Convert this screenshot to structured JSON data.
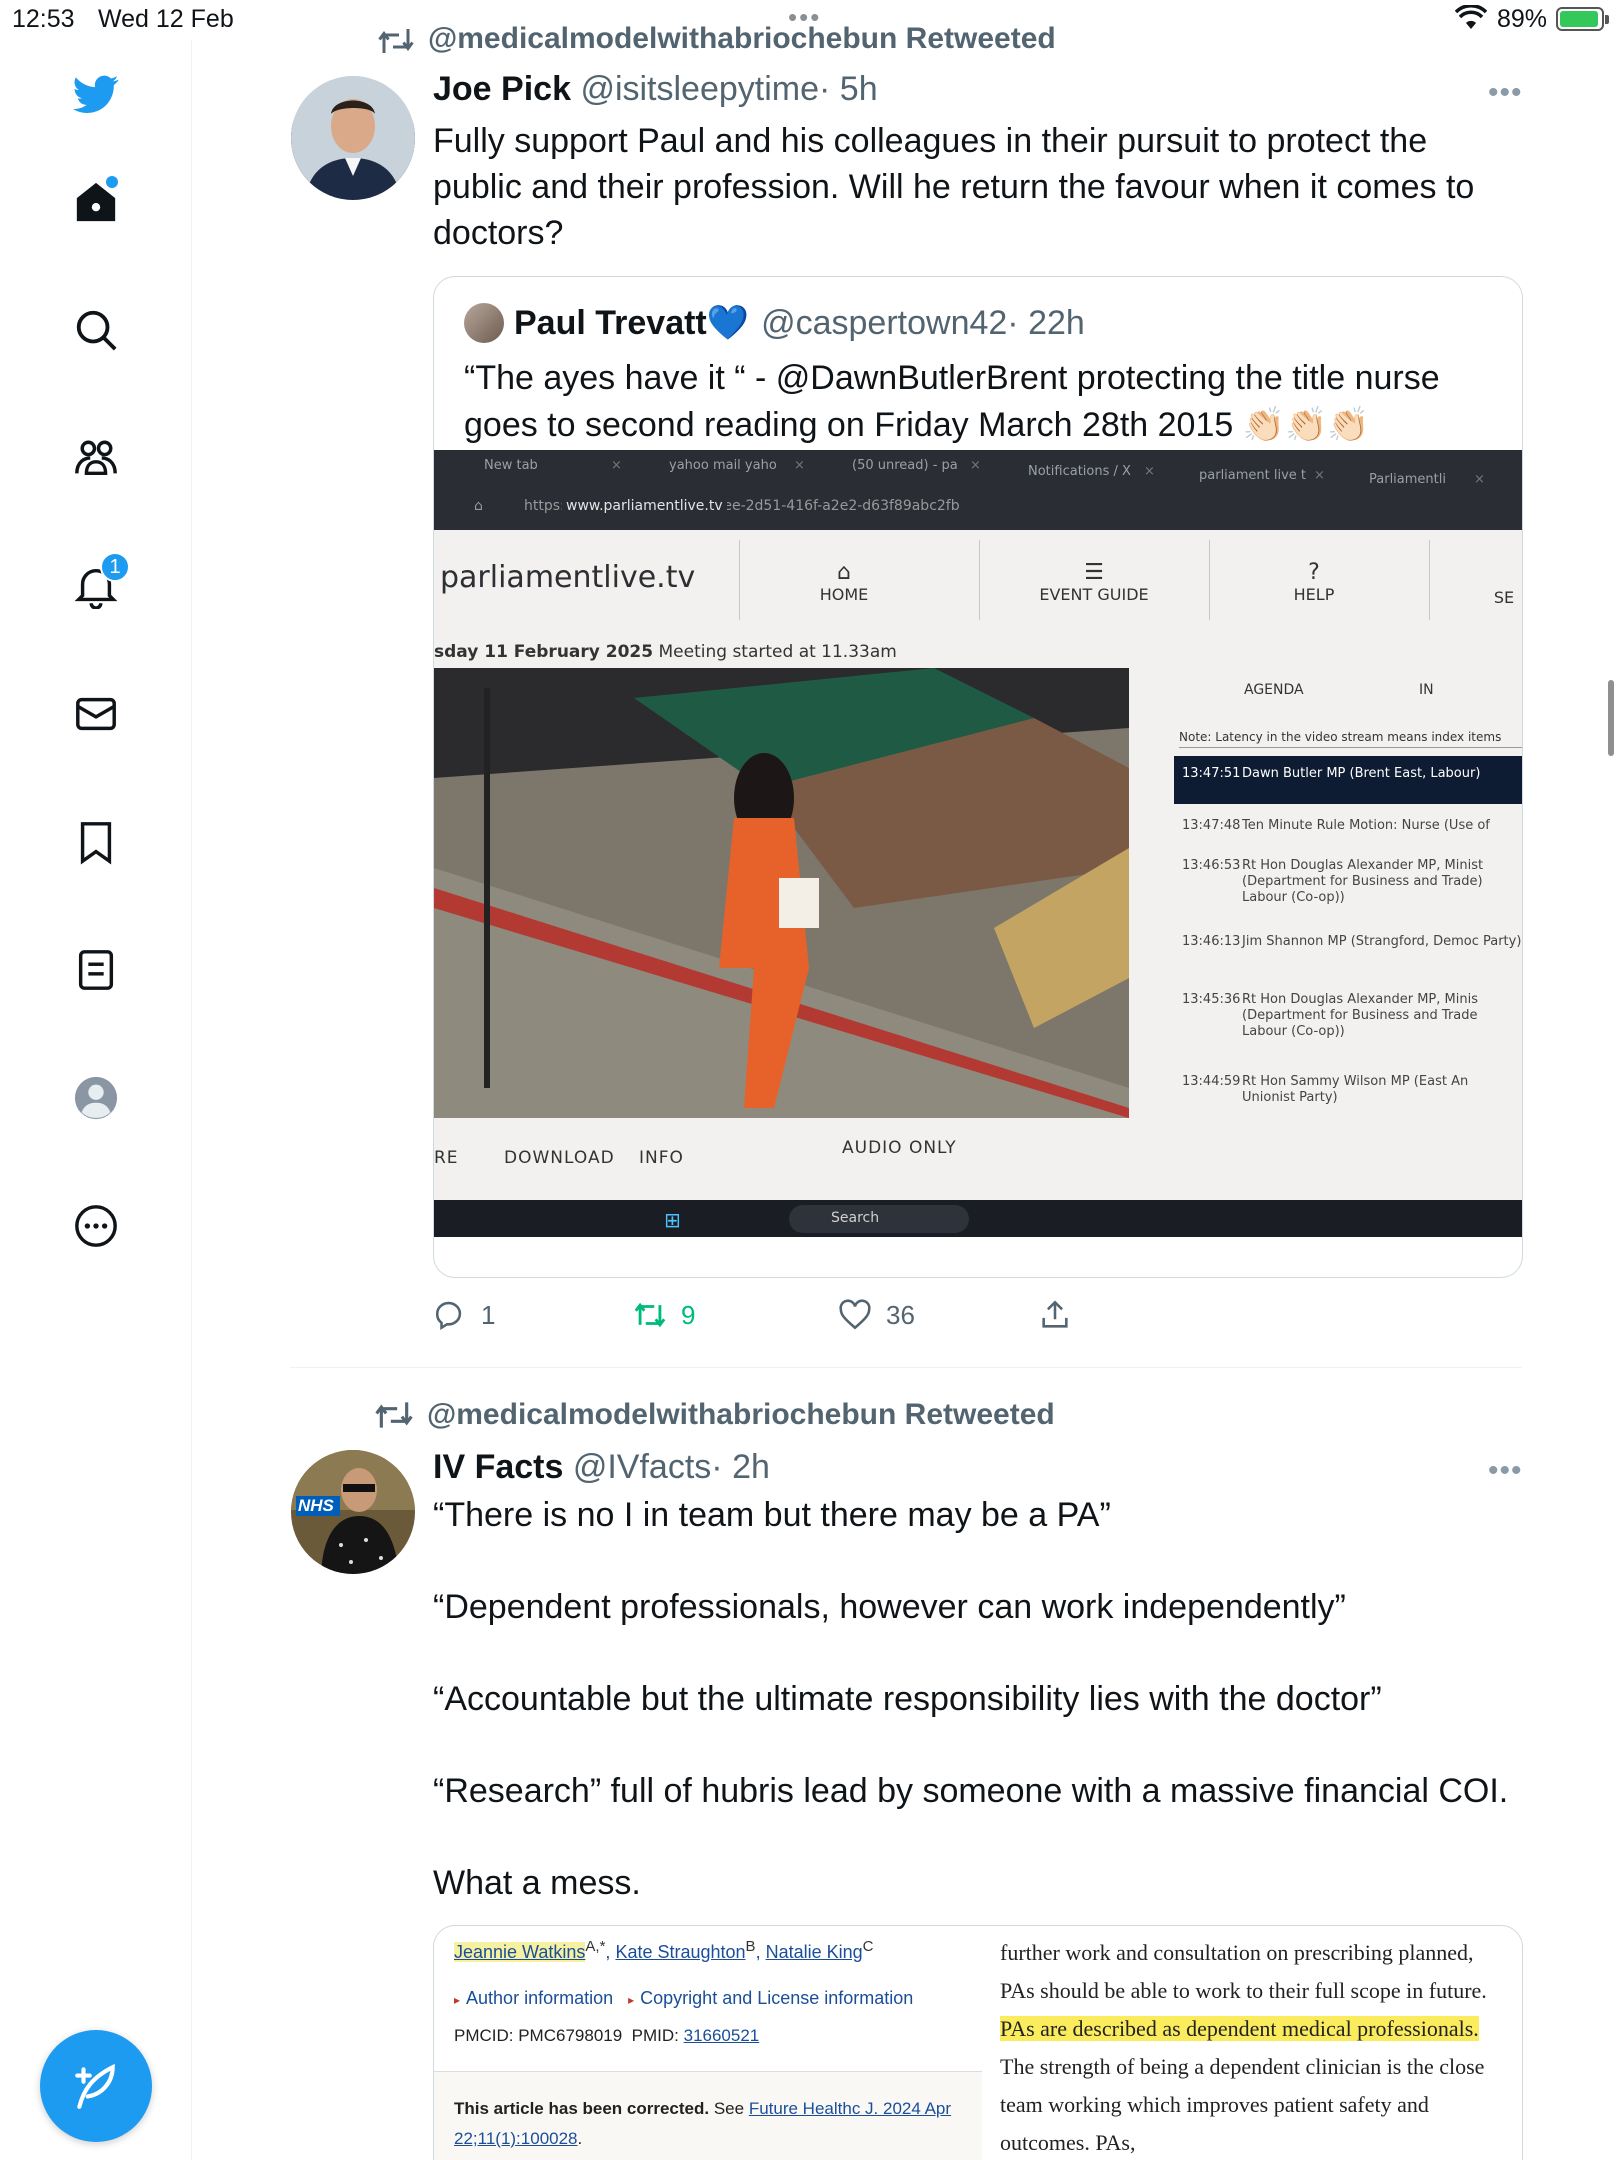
{
  "status_bar": {
    "time": "12:53",
    "date": "Wed 12 Feb",
    "battery": "89%"
  },
  "sidebar": {
    "notifications_badge": "1"
  },
  "top_retweet_label": "@medicalmodelwithabriochebun Retweeted",
  "tweet1": {
    "name": "Joe Pick",
    "handle": "@isitsleepytime",
    "time": "· 5h",
    "text": "Fully support Paul and his colleagues in their pursuit to protect the public and their profession. Will he return the favour when it comes to doctors?",
    "quote": {
      "name": "Paul Trevatt",
      "emoji": "💙",
      "handle": "@caspertown42",
      "time": "· 22h",
      "text": "“The ayes have it “ - @DawnButlerBrent protecting the title nurse goes to second reading on Friday March 28th 2015 👏🏻👏🏻👏🏻"
    },
    "photo": {
      "tabs": [
        "New tab",
        "yahoo mail yaho",
        "(50 unread) - pa",
        "Notifications / X",
        "parliament live t",
        "Parliamentli"
      ],
      "url_domain": "www.parliamentlive.tv",
      "url_path": "https://  /Event/Index/e668dcee-2d51-416f-a2e2-d63f89abc2fb",
      "site_logo": "parliamentlive.tv",
      "nav": [
        "HOME",
        "EVENT GUIDE",
        "HELP",
        "SE"
      ],
      "meeting_date": "sday 11 February 2025",
      "meeting_started": "Meeting started at 11.33am",
      "agenda_tab": "AGENDA",
      "agenda_tab2": "IN",
      "note": "Note: Latency in the video stream means index items",
      "agenda": [
        {
          "time": "13:47:51",
          "desc": "Dawn Butler MP (Brent East, Labour)"
        },
        {
          "time": "13:47:48",
          "desc": "Ten Minute Rule Motion: Nurse (Use of"
        },
        {
          "time": "13:46:53",
          "desc": "Rt Hon Douglas Alexander MP, Minist (Department for Business and Trade) Labour (Co-op))"
        },
        {
          "time": "13:46:13",
          "desc": "Jim Shannon MP (Strangford, Democ Party)"
        },
        {
          "time": "13:45:36",
          "desc": "Rt Hon Douglas Alexander MP, Minis (Department for Business and Trade Labour (Co-op))"
        },
        {
          "time": "13:44:59",
          "desc": "Rt Hon Sammy Wilson MP (East An Unionist Party)"
        }
      ],
      "controls": {
        "share": "RE",
        "download": "DOWNLOAD",
        "info": "INFO",
        "audio": "AUDIO ONLY"
      },
      "taskbar_search": "Search"
    },
    "actions": {
      "replies": "1",
      "retweets": "9",
      "likes": "36"
    }
  },
  "tweet2": {
    "retweet_label": "@medicalmodelwithabriochebun Retweeted",
    "name": "IV Facts",
    "handle": "@IVfacts",
    "time": "· 2h",
    "avatar_badge": "NHS",
    "paragraphs": [
      "“There is no I in team but there may be a PA”",
      "“Dependent professionals, however can work independently”",
      "“Accountable but the ultimate responsibility lies with the doctor”",
      "“Research” full of hubris lead by someone with a massive financial COI.",
      "What a mess."
    ],
    "doc": {
      "author1": "Jeannie Watkins",
      "author1_sup": "A,*",
      "author2": "Kate Straughton",
      "author2_sup": "B",
      "author3": "Natalie King",
      "author3_sup": "C",
      "link1": "Author information",
      "link2": "Copyright and License information",
      "pmcid_label": "PMCID: PMC6798019",
      "pmid_label": "PMID:",
      "pmid_value": "31660521",
      "corrected_bold": "This article has been corrected.",
      "corrected_see": "See",
      "corrected_link": "Future Healthc J. 2024 Apr 22;11(1):100028",
      "right_text_1": "further work and consultation on prescribing planned, PAs should be able to work to their full scope in future.",
      "right_highlight": "PAs are described as dependent medical professionals.",
      "right_text_2": "The strength of being a dependent clinician is the close team working which improves patient safety and outcomes. PAs,"
    }
  },
  "colors": {
    "twitter_blue": "#1d9bf0",
    "retweet_green": "#00ba7c",
    "secondary_text": "#536471"
  }
}
